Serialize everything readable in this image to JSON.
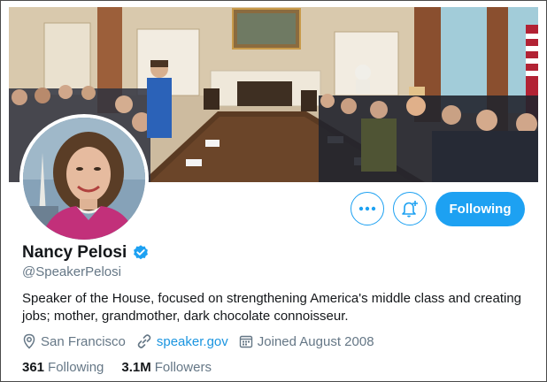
{
  "profile": {
    "name": "Nancy Pelosi",
    "handle": "@SpeakerPelosi",
    "bio": "Speaker of the House, focused on strengthening America's middle class and creating jobs; mother, grandmother, dark chocolate connoisseur.",
    "location": "San Francisco",
    "website": "speaker.gov",
    "joined": "Joined August 2008",
    "verified": true
  },
  "actions": {
    "more_icon": "more-dots-icon",
    "notify_icon": "bell-plus-icon",
    "follow_label": "Following"
  },
  "stats": {
    "following_count": "361",
    "following_label": "Following",
    "followers_count": "3.1M",
    "followers_label": "Followers"
  },
  "colors": {
    "accent": "#1da1f2",
    "link": "#1b95e0",
    "muted": "#657786",
    "text": "#14171a"
  }
}
